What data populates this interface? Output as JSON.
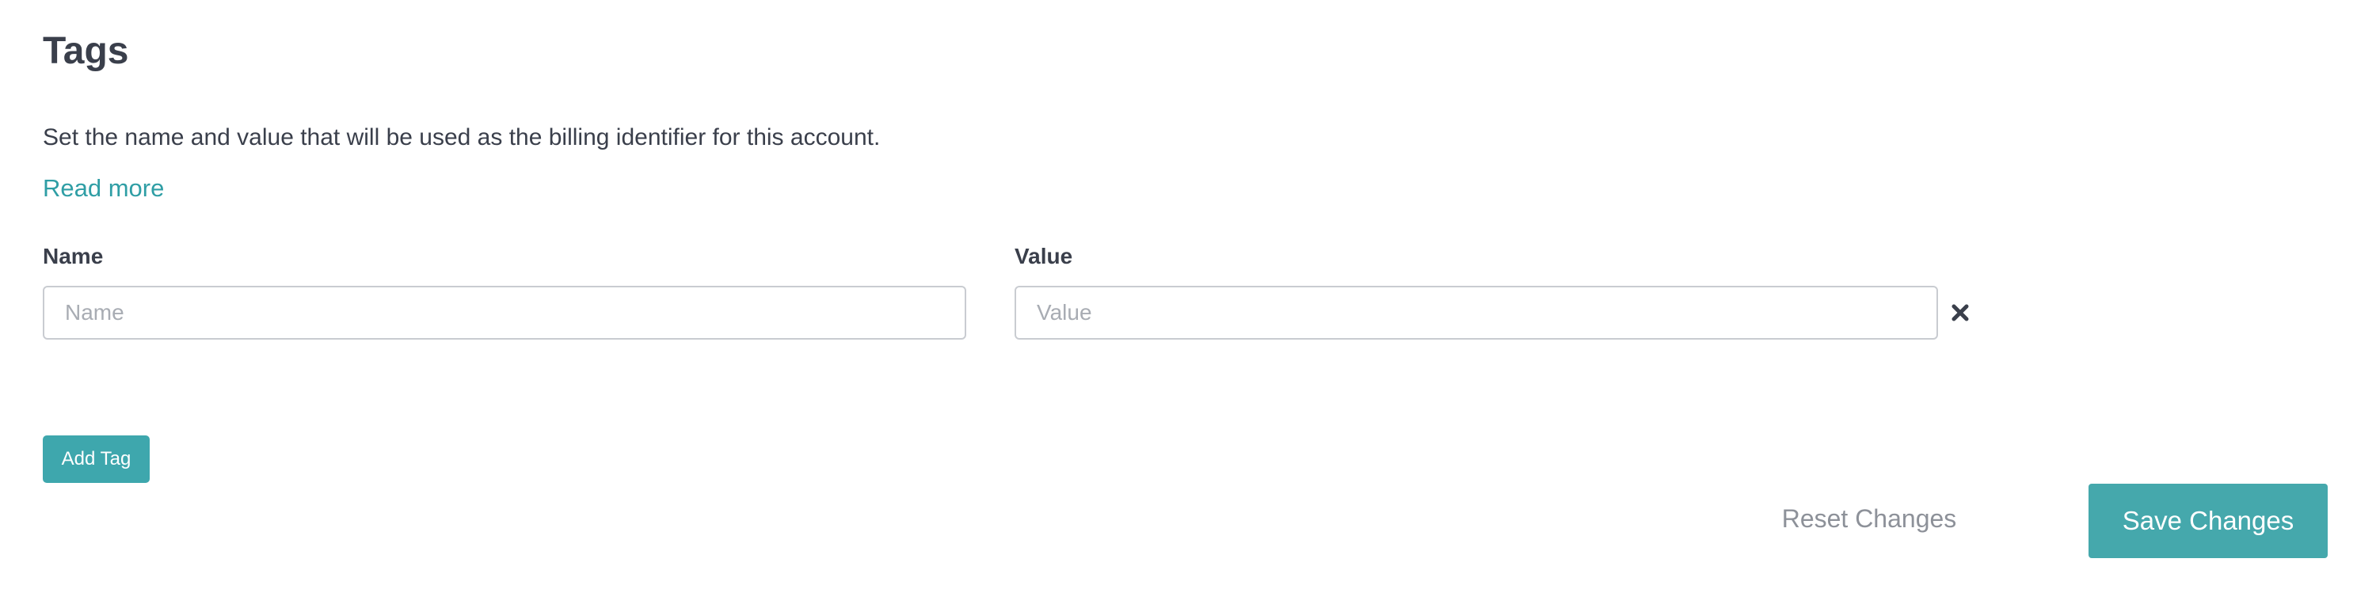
{
  "section": {
    "title": "Tags",
    "description": "Set the name and value that will be used as the billing identifier for this account.",
    "read_more": "Read more"
  },
  "tag_form": {
    "name_label": "Name",
    "name_placeholder": "Name",
    "name_value": "",
    "value_label": "Value",
    "value_placeholder": "Value",
    "value_value": "",
    "remove_icon": "close-icon"
  },
  "actions": {
    "add_tag": "Add Tag",
    "reset": "Reset Changes",
    "save": "Save Changes"
  },
  "colors": {
    "accent": "#3ea7ad",
    "link": "#2f9ea5",
    "text": "#3a3f4b",
    "muted": "#8d9199"
  }
}
